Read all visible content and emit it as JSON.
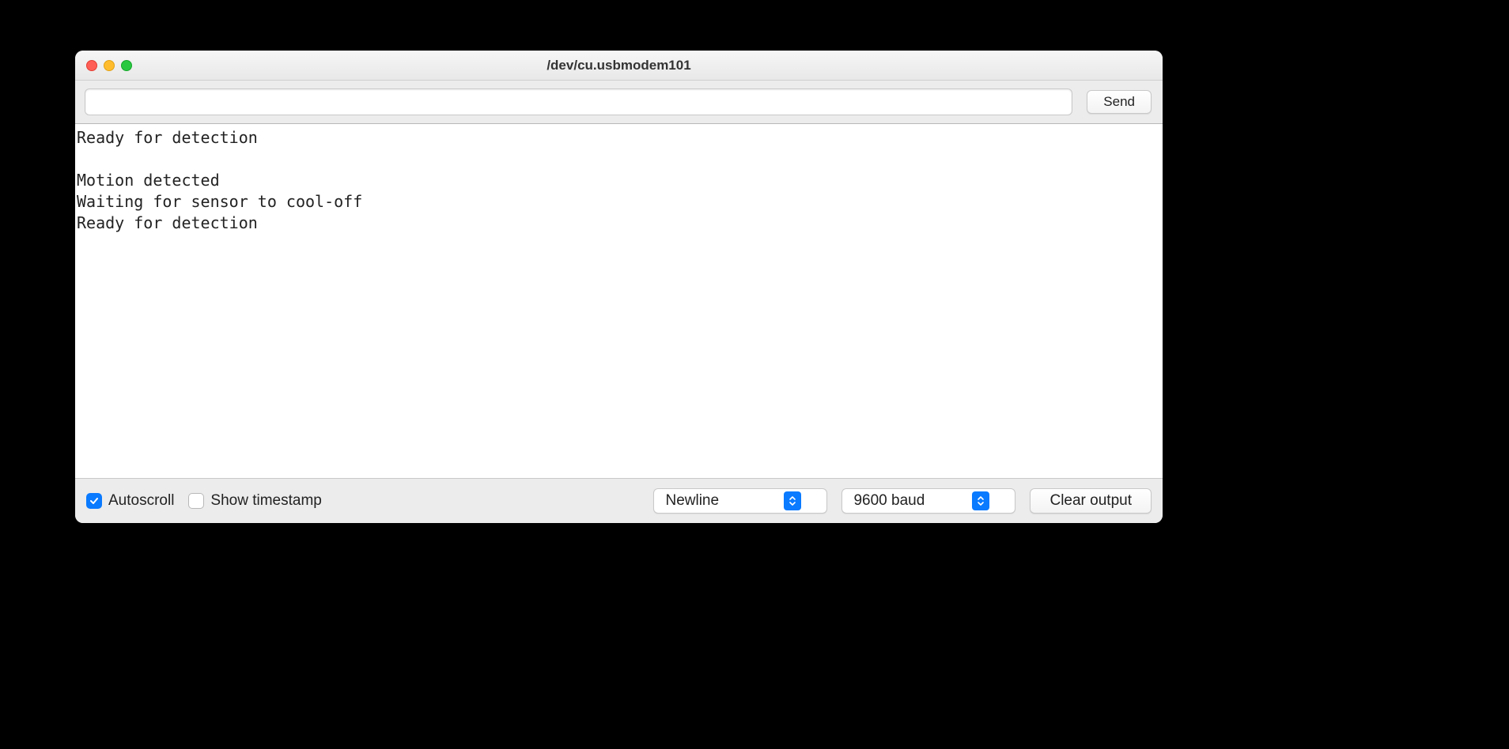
{
  "window": {
    "title": "/dev/cu.usbmodem101"
  },
  "toolbar": {
    "input_value": "",
    "send_label": "Send"
  },
  "console": {
    "lines": [
      "Ready for detection",
      "",
      "Motion detected",
      "Waiting for sensor to cool-off",
      "Ready for detection"
    ]
  },
  "footer": {
    "autoscroll": {
      "label": "Autoscroll",
      "checked": true
    },
    "show_timestamp": {
      "label": "Show timestamp",
      "checked": false
    },
    "line_ending": {
      "selected": "Newline"
    },
    "baud": {
      "selected": "9600 baud"
    },
    "clear_label": "Clear output"
  }
}
